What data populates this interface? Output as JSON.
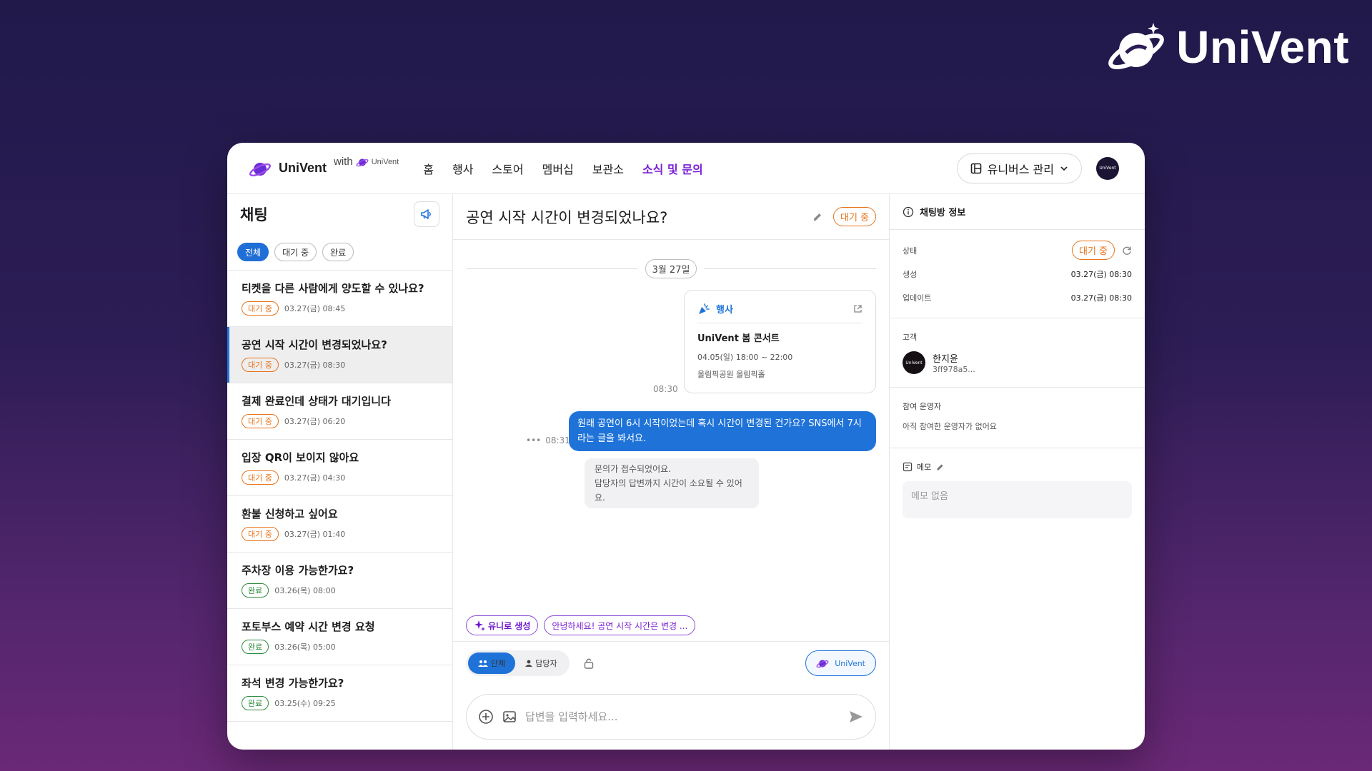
{
  "brand": {
    "name": "UniVent"
  },
  "topbar": {
    "logo_name": "UniVent",
    "with_label": "with",
    "with_brand": "UniVent",
    "nav": [
      "홈",
      "행사",
      "스토어",
      "멤버십",
      "보관소",
      "소식 및 문의"
    ],
    "active_nav_index": 5,
    "universe_button": "유니버스 관리",
    "avatar_label": "UniVent"
  },
  "sidebar": {
    "title": "채팅",
    "filters": [
      "전체",
      "대기 중",
      "완료"
    ],
    "chats": [
      {
        "title": "티켓을 다른 사람에게 양도할 수 있나요?",
        "status": "대기 중",
        "time": "03.27(금) 08:45"
      },
      {
        "title": "공연 시작 시간이 변경되었나요?",
        "status": "대기 중",
        "time": "03.27(금) 08:30"
      },
      {
        "title": "결제 완료인데 상태가 대기입니다",
        "status": "대기 중",
        "time": "03.27(금) 06:20"
      },
      {
        "title": "입장 QR이 보이지 않아요",
        "status": "대기 중",
        "time": "03.27(금) 04:30"
      },
      {
        "title": "환불 신청하고 싶어요",
        "status": "대기 중",
        "time": "03.27(금) 01:40"
      },
      {
        "title": "주차장 이용 가능한가요?",
        "status": "완료",
        "time": "03.26(목) 08:00"
      },
      {
        "title": "포토부스 예약 시간 변경 요청",
        "status": "완료",
        "time": "03.26(목) 05:00"
      },
      {
        "title": "좌석 변경 가능한가요?",
        "status": "완료",
        "time": "03.25(수) 09:25"
      }
    ]
  },
  "conversation": {
    "title": "공연 시작 시간이 변경되었나요?",
    "status": "대기 중",
    "date_divider": "3월 27일",
    "event_card": {
      "type_label": "행사",
      "name": "UniVent 봄 콘서트",
      "datetime": "04.05(일) 18:00 ~ 22:00",
      "place": "올림픽공원 올림픽홀",
      "time": "08:30"
    },
    "user_message": {
      "text": "원래 공연이 6시 시작이었는데 혹시 시간이 변경된 건가요? SNS에서 7시라는 글을 봐서요.",
      "time": "08:31"
    },
    "system_message": {
      "line1": "문의가 접수되었어요.",
      "line2": "담당자의 답변까지 시간이 소요될 수 있어요."
    },
    "suggestions": {
      "generate_label": "유니로 생성",
      "preview": "안녕하세요! 공연 시작 시간은 변경 ..."
    },
    "composer": {
      "modes": [
        "단체",
        "담당자"
      ],
      "ai_button": "UniVent",
      "placeholder": "답변을 입력하세요..."
    }
  },
  "info_panel": {
    "title": "채팅방 정보",
    "status_label": "상태",
    "status_value": "대기 중",
    "created_label": "생성",
    "created_value": "03.27(금) 08:30",
    "updated_label": "업데이트",
    "updated_value": "03.27(금) 08:30",
    "customer_label": "고객",
    "customer_name": "한지윤",
    "customer_id": "3ff978a5...",
    "operators_label": "참여 운영자",
    "operators_empty": "아직 참여한 운영자가 없어요",
    "memo_label": "메모",
    "memo_empty": "메모 없음"
  },
  "colors": {
    "accent_purple": "#7b1fd6",
    "accent_blue": "#1f73d8",
    "waiting_orange": "#e8731a",
    "done_green": "#2e8b3d"
  }
}
